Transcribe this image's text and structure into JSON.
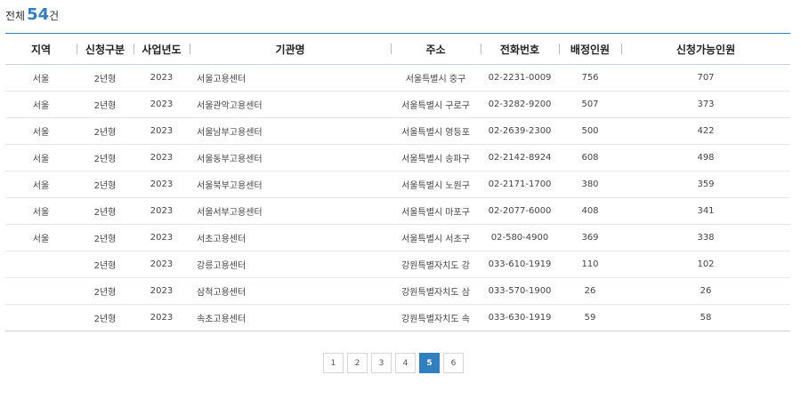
{
  "summary": {
    "prefix": "전체",
    "count": "54",
    "unit": "건"
  },
  "columns": [
    "지역",
    "신청구분",
    "사업년도",
    "기관명",
    "주소",
    "전화번호",
    "배정인원",
    "신청가능인원"
  ],
  "rows": [
    [
      "서울",
      "2년형",
      "2023",
      "서울고용센터",
      "서울특별시 중구",
      "02-2231-0009",
      "756",
      "707"
    ],
    [
      "서울",
      "2년형",
      "2023",
      "서울관악고용센터",
      "서울특별시 구로구",
      "02-3282-9200",
      "507",
      "373"
    ],
    [
      "서울",
      "2년형",
      "2023",
      "서울남부고용센터",
      "서울특별시 영등포",
      "02-2639-2300",
      "500",
      "422"
    ],
    [
      "서울",
      "2년형",
      "2023",
      "서울동부고용센터",
      "서울특별시 송파구",
      "02-2142-8924",
      "608",
      "498"
    ],
    [
      "서울",
      "2년형",
      "2023",
      "서울북부고용센터",
      "서울특별시 노원구",
      "02-2171-1700",
      "380",
      "359"
    ],
    [
      "서울",
      "2년형",
      "2023",
      "서울서부고용센터",
      "서울특별시 마포구",
      "02-2077-6000",
      "408",
      "341"
    ],
    [
      "서울",
      "2년형",
      "2023",
      "서초고용센터",
      "서울특별시 서초구",
      "02-580-4900",
      "369",
      "338"
    ],
    [
      "",
      "2년형",
      "2023",
      "강릉고용센터",
      "강원특별자치도 강",
      "033-610-1919",
      "110",
      "102"
    ],
    [
      "",
      "2년형",
      "2023",
      "삼척고용센터",
      "강원특별자치도 삼",
      "033-570-1900",
      "26",
      "26"
    ],
    [
      "",
      "2년형",
      "2023",
      "속초고용센터",
      "강원특별자치도 속",
      "033-630-1919",
      "59",
      "58"
    ]
  ],
  "pagination": {
    "pages": [
      "1",
      "2",
      "3",
      "4",
      "5",
      "6"
    ],
    "current": "5"
  },
  "colors": {
    "accent": "#2f7fc1"
  }
}
